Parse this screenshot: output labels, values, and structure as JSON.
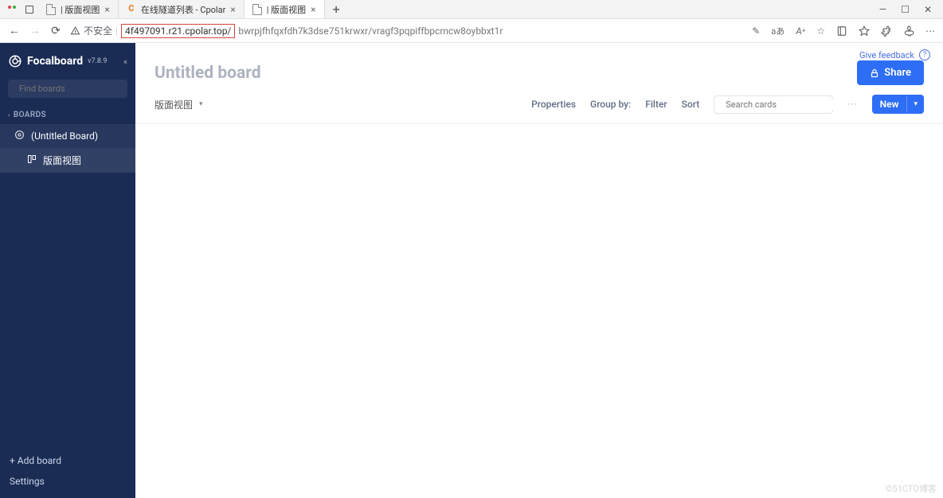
{
  "browser": {
    "tabs": [
      {
        "title": " | 版面视图",
        "type": "doc"
      },
      {
        "title": "在线隧道列表 - Cpolar",
        "type": "c"
      },
      {
        "title": " | 版面视图",
        "type": "doc",
        "active": true
      }
    ],
    "security_label": "不安全",
    "url_highlight": "4f497091.r21.cpolar.top/",
    "url_rest": "bwrpjfhfqxfdh7k3dse751krwxr/vragf3pqpiffbpcmcw8oybbxt1r"
  },
  "sidebar": {
    "brand": "Focalboard",
    "version": "v7.8.9",
    "find_placeholder": "Find boards",
    "section": "BOARDS",
    "board_item": "(Untitled Board)",
    "subitem": "版面视图",
    "add_board": "+ Add board",
    "settings": "Settings"
  },
  "main": {
    "feedback": "Give feedback",
    "title": "Untitled board",
    "share": "Share",
    "view_name": "版面视图",
    "properties": "Properties",
    "group_by": "Group by:",
    "filter": "Filter",
    "sort": "Sort",
    "search_placeholder": "Search cards",
    "new": "New"
  },
  "watermark": "©51CTO博客"
}
